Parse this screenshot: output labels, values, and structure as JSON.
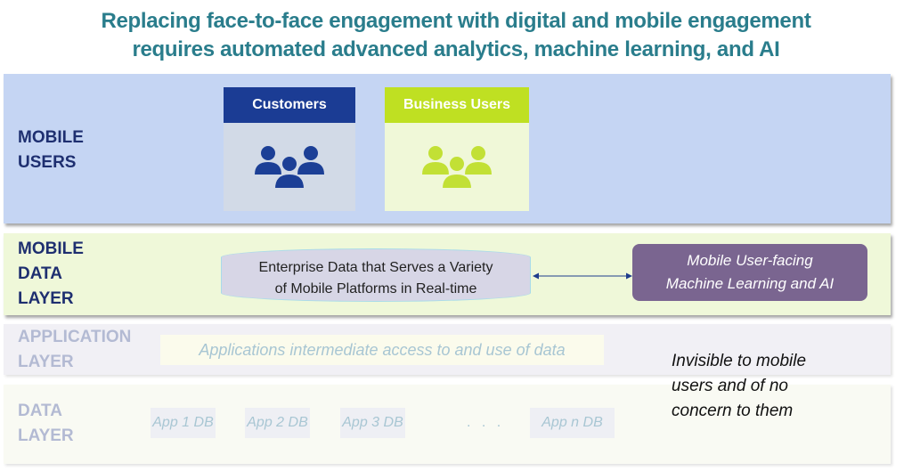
{
  "title": {
    "line1": "Replacing face-to-face engagement with digital and mobile engagement",
    "line2": "requires automated advanced analytics, machine learning, and AI"
  },
  "layers": {
    "mobile_users": {
      "label_line1": "MOBILE",
      "label_line2": "USERS",
      "cards": [
        {
          "label": "Customers",
          "icon": "people-group-icon",
          "header_color": "#1b3c94",
          "body_color": "#d2dae7",
          "icon_color": "#1c3f96"
        },
        {
          "label": "Business Users",
          "icon": "people-group-icon",
          "header_color": "#bfe022",
          "body_color": "#f0f8d8",
          "icon_color": "#c2e035"
        }
      ]
    },
    "mobile_data": {
      "label_line1": "MOBILE",
      "label_line2": "DATA",
      "label_line3": "LAYER",
      "database_line1": "Enterprise Data that Serves a Variety",
      "database_line2": "of Mobile Platforms in Real-time",
      "ml_line1": "Mobile User-facing",
      "ml_line2": "Machine Learning and AI"
    },
    "application": {
      "label_line1": "APPLICATION",
      "label_line2": "LAYER",
      "description": "Applications intermediate access to and use of data"
    },
    "data": {
      "label_line1": "DATA",
      "label_line2": "LAYER",
      "databases": [
        "App 1 DB",
        "App 2 DB",
        "App 3 DB",
        "App n DB"
      ],
      "ellipsis": ". . ."
    }
  },
  "note": {
    "line1": "Invisible to mobile",
    "line2": "users and of no",
    "line3": "concern to them"
  }
}
